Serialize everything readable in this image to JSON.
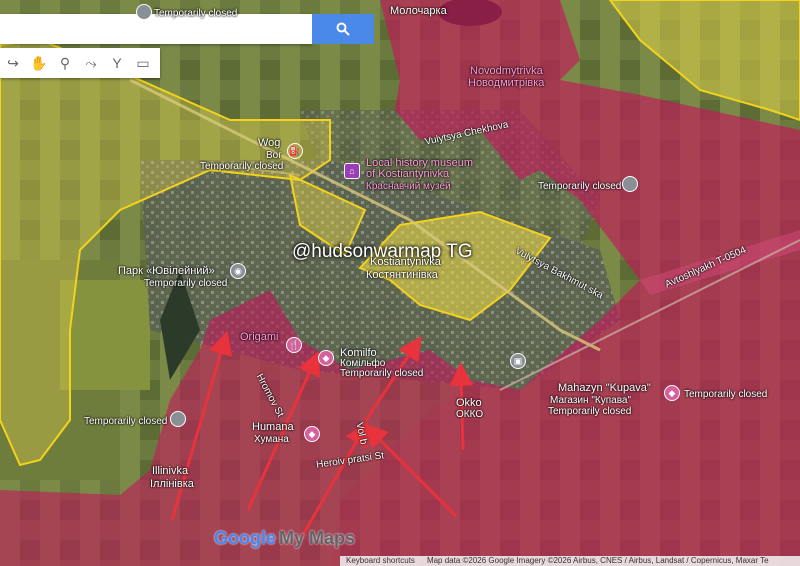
{
  "search": {
    "placeholder": ""
  },
  "watermark": "@hudsonwarmap TG",
  "branding": {
    "google": "Google",
    "mymaps": "My Maps"
  },
  "footer": {
    "shortcuts": "Keyboard shortcuts",
    "attribution": "Map data ©2026 Google Imagery ©2026 Airbus, CNES / Airbus, Landsat / Copernicus, Maxar Te"
  },
  "colors": {
    "russian_control": "#c2185b",
    "contested": "#e8d84a",
    "border": "#f2d21b",
    "arrow": "#e8323c"
  },
  "labels": {
    "temporarily_closed": "Temporarily closed",
    "molochka_ru": "Молочарка",
    "novodmytrivka_en": "Novodmytrivka",
    "novodmytrivka_ru": "Новодмитрівка",
    "wog": "Wog",
    "wog_sub": "Вог",
    "vulytsya_chekhova": "Vulytsya Chekhova",
    "museum_en": "Local history museum",
    "museum_en2": "of Kostiantynivka",
    "museum_ru": "Краснавчий музей",
    "kostiantynivka_en": "Kostiantynivka",
    "kostiantynivka_ru": "Костянтинівка",
    "bakhmutska": "Vulytsya Bakhmut ska",
    "avtoshlyakh": "Avtoshlyakh T-0504",
    "park": "Парк «Ювілейний»",
    "origami": "Origami",
    "komilfo_en": "Komilfo",
    "komilfo_ru": "Комільфо",
    "okko_en": "Okko",
    "okko_ru": "ОККО",
    "kupava_en": "Mahazyn \"Kupava\"",
    "kupava_ru": "Магазин \"Купава\"",
    "humana_en": "Humana",
    "humana_ru": "Хумана",
    "hromov_st": "Hromov St",
    "heroiv_st": "Heroiv pratsi St",
    "vol_st": "Vol b",
    "illinivka_en": "Illinivka",
    "illinivka_ru": "Іллінівка"
  }
}
